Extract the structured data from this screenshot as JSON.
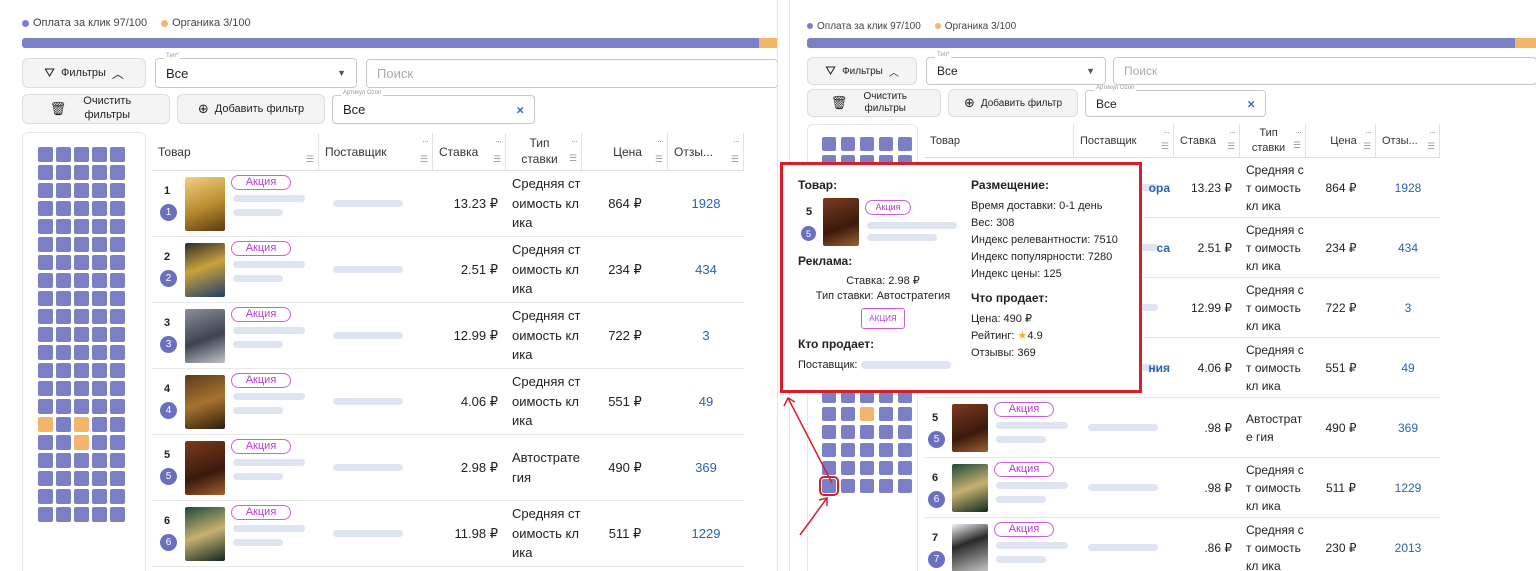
{
  "left": {
    "legend": {
      "paid": "Оплата за клик 97/100",
      "organic": "Органика 3/100"
    },
    "filters_label": "Фильтры",
    "clear_label": "Очистить фильтры",
    "add_filter_label": "Добавить фильтр",
    "type_select": {
      "label": "Тип*",
      "value": "Все"
    },
    "search_placeholder": "Поиск",
    "article_select": {
      "label": "Артикул Ozon",
      "value": "Все"
    },
    "columns": [
      "Товар",
      "Поставщик",
      "Ставка",
      "Тип ставки",
      "Цена",
      "Отзы..."
    ],
    "rows": [
      {
        "n": "1",
        "badge": "1",
        "tag": "Акция",
        "bid": "13.23 ₽",
        "type": "Средняя ст оимость кл ика",
        "price": "864 ₽",
        "reviews": "1928"
      },
      {
        "n": "2",
        "badge": "2",
        "tag": "Акция",
        "bid": "2.51 ₽",
        "type": "Средняя ст оимость кл ика",
        "price": "234 ₽",
        "reviews": "434"
      },
      {
        "n": "3",
        "badge": "3",
        "tag": "Акция",
        "bid": "12.99 ₽",
        "type": "Средняя ст оимость кл ика",
        "price": "722 ₽",
        "reviews": "3"
      },
      {
        "n": "4",
        "badge": "4",
        "tag": "Акция",
        "bid": "4.06 ₽",
        "type": "Средняя ст оимость кл ика",
        "price": "551 ₽",
        "reviews": "49"
      },
      {
        "n": "5",
        "badge": "5",
        "tag": "Акция",
        "bid": "2.98 ₽",
        "type": "Автострате гия",
        "price": "490 ₽",
        "reviews": "369"
      },
      {
        "n": "6",
        "badge": "6",
        "tag": "Акция",
        "bid": "11.98 ₽",
        "type": "Средняя ст оимость кл ика",
        "price": "511 ₽",
        "reviews": "1229"
      }
    ]
  },
  "right": {
    "legend": {
      "paid": "Оплата за клик 97/100",
      "organic": "Органика 3/100"
    },
    "filters_label": "Фильтры",
    "clear_label": "Очистить фильтры",
    "add_filter_label": "Добавить фильтр",
    "type_select": {
      "label": "Тип*",
      "value": "Все"
    },
    "search_placeholder": "Поиск",
    "article_select": {
      "label": "Артикул Ozon",
      "value": "Все"
    },
    "columns": [
      "Товар",
      "Поставщик",
      "Ставка",
      "Тип ставки",
      "Цена",
      "Отзы..."
    ],
    "rows": [
      {
        "n": "",
        "badge": "",
        "tag": "",
        "supplier_frag": "ора",
        "bid": "13.23 ₽",
        "type": "Средняя ст оимость кл ика",
        "price": "864 ₽",
        "reviews": "1928"
      },
      {
        "n": "",
        "badge": "",
        "tag": "",
        "supplier_frag": "са",
        "bid": "2.51 ₽",
        "type": "Средняя ст оимость кл ика",
        "price": "234 ₽",
        "reviews": "434"
      },
      {
        "n": "",
        "badge": "",
        "tag": "",
        "supplier_frag": "",
        "bid": "12.99 ₽",
        "type": "Средняя ст оимость кл ика",
        "price": "722 ₽",
        "reviews": "3"
      },
      {
        "n": "",
        "badge": "",
        "tag": "",
        "supplier_frag": "ния",
        "bid": "4.06 ₽",
        "type": "Средняя ст оимость кл ика",
        "price": "551 ₽",
        "reviews": "49"
      },
      {
        "n": "5",
        "badge": "5",
        "tag": "Акция",
        "supplier_frag": "",
        "bid": ".98 ₽",
        "type": "Автострате гия",
        "price": "490 ₽",
        "reviews": "369"
      },
      {
        "n": "6",
        "badge": "6",
        "tag": "Акция",
        "supplier_frag": "",
        "bid": ".98 ₽",
        "type": "Средняя ст оимость кл ика",
        "price": "511 ₽",
        "reviews": "1229"
      },
      {
        "n": "7",
        "badge": "7",
        "tag": "Акция",
        "supplier_frag": "",
        "bid": ".86 ₽",
        "type": "Средняя ст оимость кл ика",
        "price": "230 ₽",
        "reviews": "2013"
      }
    ]
  },
  "popup": {
    "product_title": "Товар:",
    "product_n": "5",
    "product_badge": "5",
    "product_tag": "Акция",
    "ad_title": "Реклама:",
    "ad_bid": "Ставка: 2.98 ₽",
    "ad_type": "Тип ставки: Автостратегия",
    "ad_tag": "АКЦИЯ",
    "seller_title": "Кто продает:",
    "seller_label": "Поставщик:",
    "placement_title": "Размещение:",
    "delivery": "Время доставки: 0-1 день",
    "weight": "Вес: 308",
    "relevance": "Индекс релевантности: 7510",
    "popularity": "Индекс популярности: 7280",
    "price_index": "Индекс цены: 125",
    "sells_title": "Что продает:",
    "price": "Цена: 490 ₽",
    "rating_label": "Рейтинг:",
    "rating_value": "4.9",
    "reviews": "Отзывы: 369"
  },
  "colors": {
    "paid": "#7b7fc6",
    "organic": "#f3b46c",
    "highlight": "#d81e2a",
    "link": "#2b62b4",
    "tag": "#c95ee0"
  },
  "progress": {
    "paid": 97,
    "organic": 3
  }
}
